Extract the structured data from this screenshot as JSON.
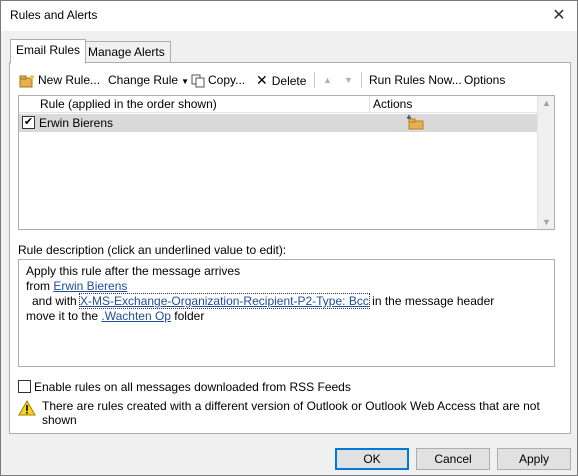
{
  "window": {
    "title": "Rules and Alerts"
  },
  "tabs": [
    {
      "label": "Email Rules"
    },
    {
      "label": "Manage Alerts"
    }
  ],
  "toolbar": {
    "new_rule": "New Rule...",
    "change_rule": "Change Rule",
    "copy": "Copy...",
    "delete": "Delete",
    "run_rules_now": "Run Rules Now...",
    "options": "Options"
  },
  "rules_table": {
    "columns": [
      "Rule (applied in the order shown)",
      "Actions"
    ],
    "rows": [
      {
        "name": "Erwin Bierens",
        "enabled": true
      }
    ]
  },
  "description": {
    "label": "Rule description (click an underlined value to edit):",
    "line1": "Apply this rule after the message arrives",
    "line2_prefix": "from ",
    "line2_link": "Erwin Bierens",
    "line3_prefix": "and with ",
    "line3_link": "X-MS-Exchange-Organization-Recipient-P2-Type: Bcc",
    "line3_suffix": " in the message header",
    "line4_prefix": "move it to the ",
    "line4_link": ".Wachten Op",
    "line4_suffix": " folder"
  },
  "rss_option": {
    "label": "Enable rules on all messages downloaded from RSS Feeds",
    "checked": false
  },
  "warning": {
    "text": "There are rules created with a different version of Outlook or Outlook Web Access that are not shown"
  },
  "buttons": {
    "ok": "OK",
    "cancel": "Cancel",
    "apply": "Apply"
  },
  "colors": {
    "link": "#1f4e9c",
    "selected_row": "#d9d9d9",
    "default_button_border": "#0078d7"
  }
}
